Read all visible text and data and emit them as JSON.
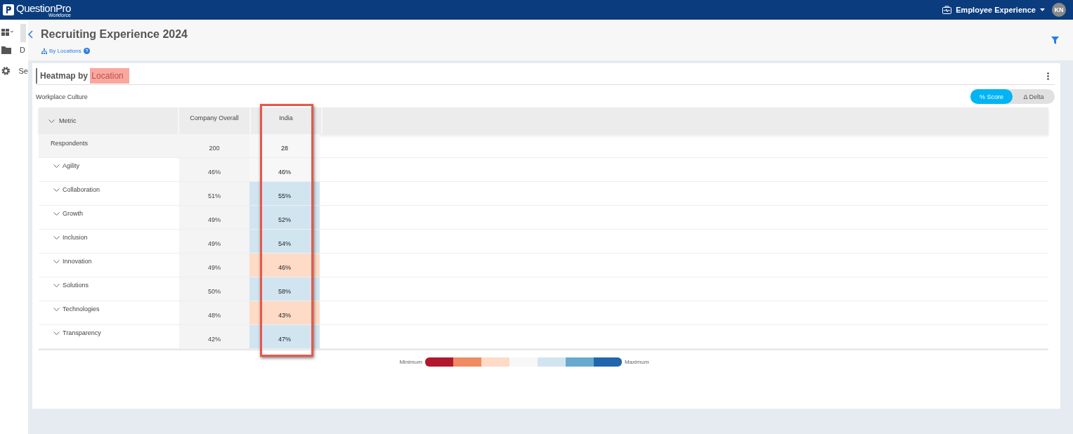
{
  "topbar": {
    "brand": "QuestionPro",
    "brand_sub": "Workforce",
    "product": "Employee Experience",
    "avatar": "KN"
  },
  "sidebar": {
    "items": [
      {
        "label": "D"
      },
      {
        "label": "Se"
      }
    ]
  },
  "header": {
    "title": "Recruiting Experience 2024",
    "breadcrumb": "By Locations"
  },
  "card": {
    "heading": "Heatmap by",
    "heading_highlight": "Location",
    "subtitle": "Workplace Culture",
    "toggle": [
      {
        "label": "% Score",
        "selected": true
      },
      {
        "label": "Δ Delta",
        "selected": false
      }
    ],
    "table": {
      "columns": [
        "Metric",
        "Company Overall",
        "India"
      ],
      "rows": [
        {
          "label": "Respondents",
          "kind": "count",
          "values": [
            "200",
            "28"
          ],
          "color": "#f7f7f7"
        },
        {
          "label": "Agility",
          "kind": "metric",
          "values": [
            "46%",
            "46%"
          ],
          "color": "#f7f7f7"
        },
        {
          "label": "Collaboration",
          "kind": "metric",
          "values": [
            "51%",
            "55%"
          ],
          "color": "#d1e5f0"
        },
        {
          "label": "Growth",
          "kind": "metric",
          "values": [
            "49%",
            "52%"
          ],
          "color": "#d1e5f0"
        },
        {
          "label": "Inclusion",
          "kind": "metric",
          "values": [
            "49%",
            "54%"
          ],
          "color": "#d1e5f0"
        },
        {
          "label": "Innovation",
          "kind": "metric",
          "values": [
            "49%",
            "46%"
          ],
          "color": "#fddbc7"
        },
        {
          "label": "Solutions",
          "kind": "metric",
          "values": [
            "50%",
            "58%"
          ],
          "color": "#d1e5f0"
        },
        {
          "label": "Technologies",
          "kind": "metric",
          "values": [
            "48%",
            "43%"
          ],
          "color": "#fddbc7"
        },
        {
          "label": "Transparency",
          "kind": "metric",
          "values": [
            "42%",
            "47%"
          ],
          "color": "#d1e5f0"
        }
      ]
    },
    "legend": {
      "min": "Minimum",
      "max": "Maximum",
      "swatches": [
        {
          "color": "#b2182b"
        },
        {
          "color": "#ef8a62"
        },
        {
          "color": "#fddbc7"
        },
        {
          "color": "#f7f7f7"
        },
        {
          "color": "#d1e5f0"
        },
        {
          "color": "#67a9cf"
        },
        {
          "color": "#2166ac"
        }
      ]
    }
  }
}
